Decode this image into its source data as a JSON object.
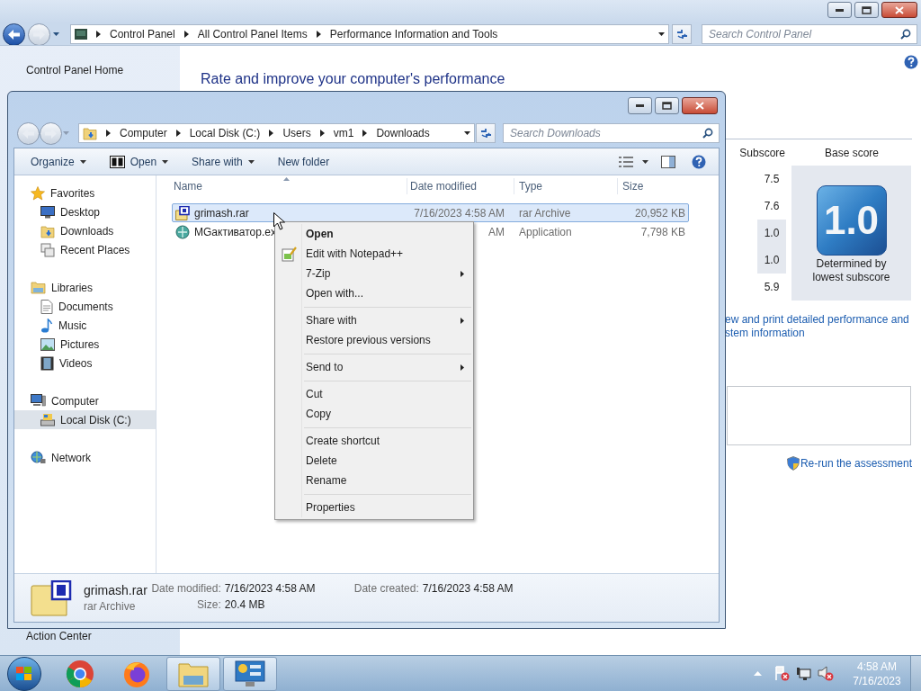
{
  "control_panel": {
    "address_path": [
      "Control Panel",
      "All Control Panel Items",
      "Performance Information and Tools"
    ],
    "search_placeholder": "Search Control Panel",
    "sidebar_links": [
      "Control Panel Home",
      "Action Center"
    ],
    "heading": "Rate and improve your computer's performance",
    "score_columns": [
      "Subscore",
      "Base score"
    ],
    "subscores": [
      {
        "value": "7.5",
        "lowest": false
      },
      {
        "value": "7.6",
        "lowest": false
      },
      {
        "value": "1.0",
        "lowest": true
      },
      {
        "value": "1.0",
        "lowest": true
      },
      {
        "value": "5.9",
        "lowest": false
      }
    ],
    "base_score": "1.0",
    "base_score_caption": "Determined by lowest subscore",
    "details_link_lines": [
      "ew and print detailed performance and",
      "stem information"
    ],
    "rerun_link": "Re-run the assessment"
  },
  "explorer": {
    "address_path": [
      "Computer",
      "Local Disk (C:)",
      "Users",
      "vm1",
      "Downloads"
    ],
    "search_placeholder": "Search Downloads",
    "toolbar": [
      {
        "label": "Organize",
        "kind": "plain",
        "dropdown": true
      },
      {
        "label": "Open",
        "kind": "open",
        "dropdown": true
      },
      {
        "label": "Share with",
        "kind": "plain",
        "dropdown": true
      },
      {
        "label": "New folder",
        "kind": "plain",
        "dropdown": false
      }
    ],
    "nav": [
      {
        "label": "Favorites",
        "kind": "star",
        "selected": false,
        "children": [
          {
            "label": "Desktop",
            "kind": "desktop",
            "selected": false
          },
          {
            "label": "Downloads",
            "kind": "downloads",
            "selected": false
          },
          {
            "label": "Recent Places",
            "kind": "recent",
            "selected": false
          }
        ]
      },
      {
        "label": "Libraries",
        "kind": "library",
        "selected": false,
        "children": [
          {
            "label": "Documents",
            "kind": "documents",
            "selected": false
          },
          {
            "label": "Music",
            "kind": "music",
            "selected": false
          },
          {
            "label": "Pictures",
            "kind": "pictures",
            "selected": false
          },
          {
            "label": "Videos",
            "kind": "videos",
            "selected": false
          }
        ]
      },
      {
        "label": "Computer",
        "kind": "computer",
        "selected": false,
        "children": [
          {
            "label": "Local Disk (C:)",
            "kind": "disk",
            "selected": true
          }
        ]
      },
      {
        "label": "Network",
        "kind": "network",
        "selected": false
      }
    ],
    "columns": [
      "Name",
      "Date modified",
      "Type",
      "Size"
    ],
    "files": [
      {
        "name": "grimash.rar",
        "kind": "rar",
        "date": "7/16/2023 4:58 AM",
        "type": "rar Archive",
        "size": "20,952 KB",
        "selected": true
      },
      {
        "name": "MGактиватор.ex",
        "kind": "exe",
        "date": "AM",
        "type": "Application",
        "size": "7,798 KB",
        "selected": false
      }
    ],
    "details": {
      "name": "grimash.rar",
      "type": "rar Archive",
      "fields": [
        {
          "label": "Date modified:",
          "value": "7/16/2023 4:58 AM"
        },
        {
          "label": "Date created:",
          "value": "7/16/2023 4:58 AM"
        },
        {
          "label": "Size:",
          "value": "20.4 MB"
        }
      ]
    }
  },
  "context_menu": [
    {
      "kind": "item",
      "label": "Open",
      "default": true,
      "icon": false,
      "submenu": false
    },
    {
      "kind": "item",
      "label": "Edit with Notepad++",
      "default": false,
      "icon": true,
      "submenu": false
    },
    {
      "kind": "item",
      "label": "7-Zip",
      "default": false,
      "icon": false,
      "submenu": true
    },
    {
      "kind": "item",
      "label": "Open with...",
      "default": false,
      "icon": false,
      "submenu": false
    },
    {
      "kind": "separator"
    },
    {
      "kind": "item",
      "label": "Share with",
      "default": false,
      "icon": false,
      "submenu": true
    },
    {
      "kind": "item",
      "label": "Restore previous versions",
      "default": false,
      "icon": false,
      "submenu": false
    },
    {
      "kind": "separator"
    },
    {
      "kind": "item",
      "label": "Send to",
      "default": false,
      "icon": false,
      "submenu": true
    },
    {
      "kind": "separator"
    },
    {
      "kind": "item",
      "label": "Cut",
      "default": false,
      "icon": false,
      "submenu": false
    },
    {
      "kind": "item",
      "label": "Copy",
      "default": false,
      "icon": false,
      "submenu": false
    },
    {
      "kind": "separator"
    },
    {
      "kind": "item",
      "label": "Create shortcut",
      "default": false,
      "icon": false,
      "submenu": false
    },
    {
      "kind": "item",
      "label": "Delete",
      "default": false,
      "icon": false,
      "submenu": false
    },
    {
      "kind": "item",
      "label": "Rename",
      "default": false,
      "icon": false,
      "submenu": false
    },
    {
      "kind": "separator"
    },
    {
      "kind": "item",
      "label": "Properties",
      "default": false,
      "icon": false,
      "submenu": false
    }
  ],
  "taskbar": {
    "apps": [
      {
        "kind": "chrome",
        "active": false
      },
      {
        "kind": "firefox",
        "active": false
      },
      {
        "kind": "explorer",
        "active": true
      },
      {
        "kind": "control_panel",
        "active": true
      }
    ],
    "clock_time": "4:58 AM",
    "clock_date": "7/16/2023"
  }
}
